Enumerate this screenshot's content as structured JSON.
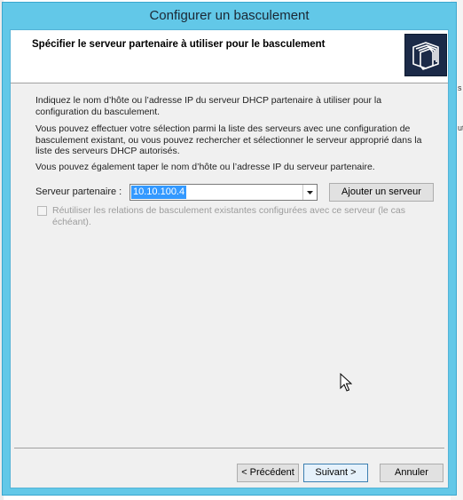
{
  "window": {
    "title": "Configurer un basculement"
  },
  "header": {
    "title": "Spécifier le serveur partenaire à utiliser pour le basculement"
  },
  "body": {
    "paragraph_1": "Indiquez le nom d’hôte ou l’adresse IP du serveur DHCP partenaire à utiliser pour la configuration du basculement.",
    "paragraph_2": "Vous pouvez effectuer votre sélection parmi la liste des serveurs avec une configuration de basculement existant, ou vous pouvez rechercher et sélectionner le serveur approprié dans la liste des serveurs DHCP autorisés.",
    "paragraph_3": "Vous pouvez également taper le nom d’hôte ou l’adresse IP du serveur partenaire."
  },
  "partner": {
    "label": "Serveur partenaire :",
    "value": "10.10.100.4",
    "add_button": "Ajouter un serveur"
  },
  "reuse": {
    "label": "Réutiliser les relations de basculement existantes configurées avec ce serveur (le cas échéant).",
    "checked": false,
    "enabled": false
  },
  "footer": {
    "back": "< Précédent",
    "next": "Suivant >",
    "cancel": "Annuler"
  },
  "background_fragments": {
    "r1": "s",
    "r2": "ut"
  },
  "colors": {
    "titlebar": "#62c8e8",
    "selection": "#3399ff",
    "panel": "#f0f0f0"
  },
  "icons": {
    "header": "wizard-folders-icon",
    "cursor": "mouse-pointer-icon"
  }
}
